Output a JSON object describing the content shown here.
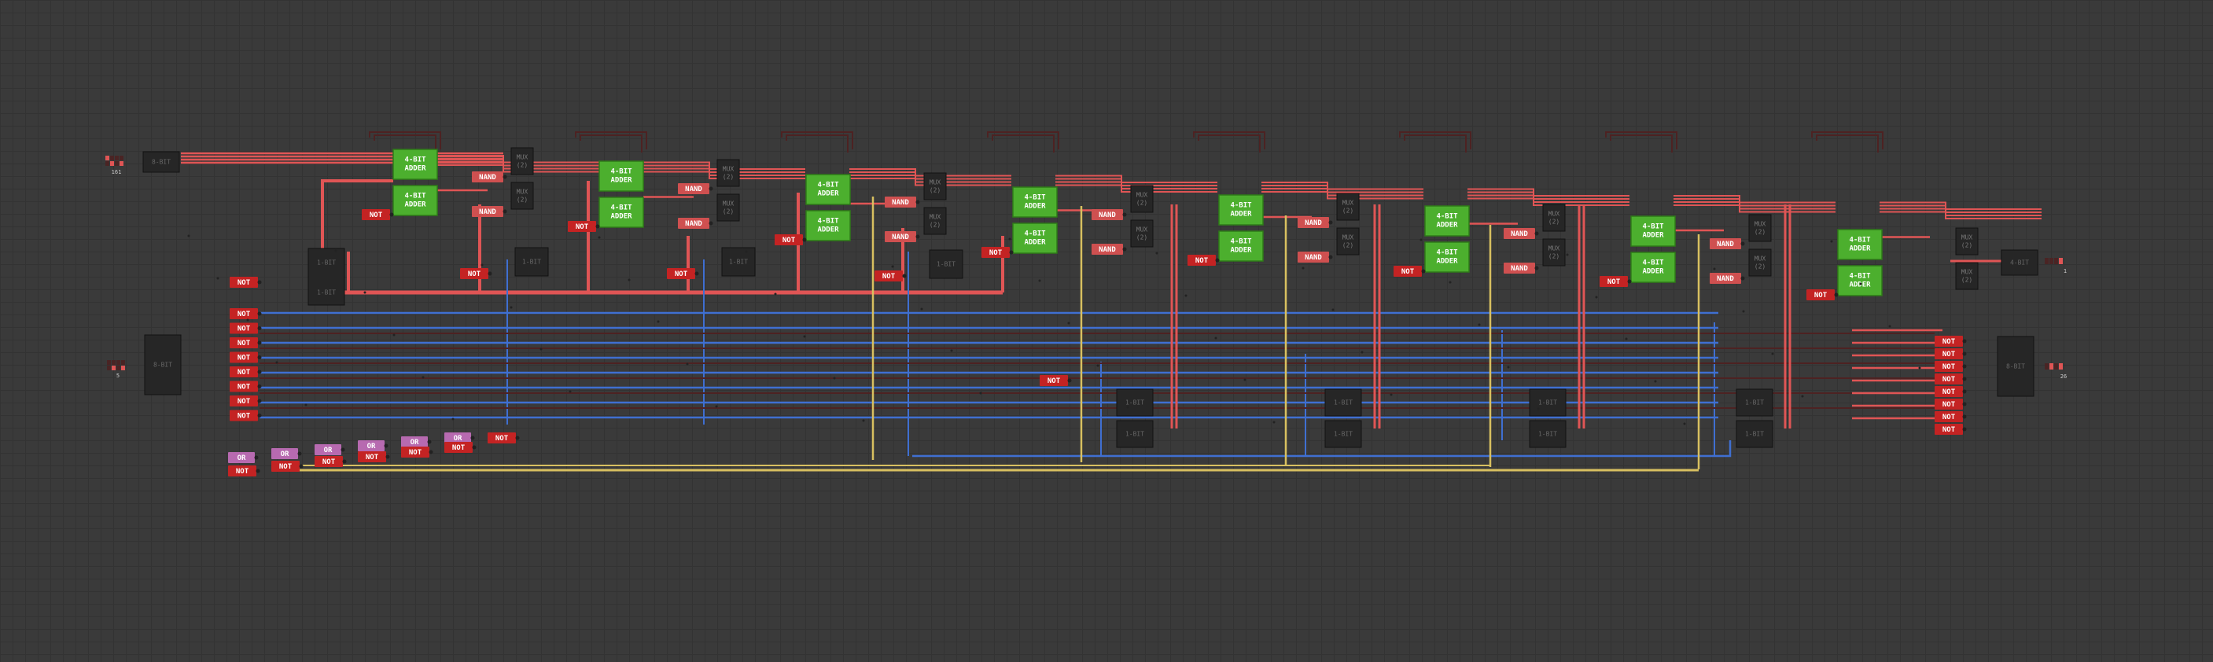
{
  "colors": {
    "background": "#3a3a3a",
    "wire_active": "#e05555",
    "wire_inactive": "#4d2222",
    "wire_blue": "#3f6fd1",
    "wire_yellow": "#d8c060",
    "adder": "#4caf2e",
    "not_gate": "#c42323",
    "nand_gate": "#cf5050",
    "or_gate": "#b76ab0",
    "chip": "#262626"
  },
  "labels": {
    "adder_line1": "4-BIT",
    "adder_line2": "ADDER",
    "mux_line1": "MUX",
    "mux_line2": "(2)",
    "not": "NOT",
    "nand": "NAND",
    "or": "OR",
    "bit8": "8-BIT",
    "bit4": "4-BIT",
    "bit1": "1-BIT"
  },
  "io": {
    "input_a_value": "161",
    "input_b_value": "5",
    "output_sum_value": "1",
    "output_overflow_value": "26"
  }
}
